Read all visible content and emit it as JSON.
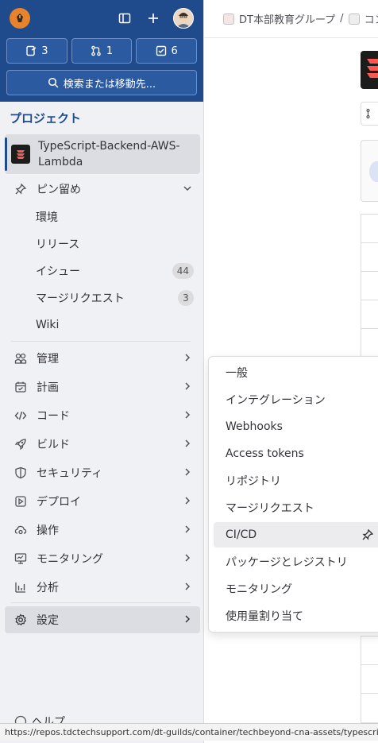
{
  "header": {
    "counters": [
      {
        "icon": "issues-icon",
        "count": "3"
      },
      {
        "icon": "merge-request-icon",
        "count": "1"
      },
      {
        "icon": "todo-icon",
        "count": "6"
      }
    ],
    "search_label": "検索または移動先..."
  },
  "sidebar": {
    "section_title": "プロジェクト",
    "project_name": "TypeScript-Backend-AWS-Lambda",
    "pinned": {
      "label": "ピン留め",
      "items": [
        {
          "label": "環境",
          "badge": ""
        },
        {
          "label": "リリース",
          "badge": ""
        },
        {
          "label": "イシュー",
          "badge": "44"
        },
        {
          "label": "マージリクエスト",
          "badge": "3"
        },
        {
          "label": "Wiki",
          "badge": ""
        }
      ]
    },
    "groups": [
      {
        "label": "管理",
        "icon": "users-icon"
      },
      {
        "label": "計画",
        "icon": "calendar-icon"
      },
      {
        "label": "コード",
        "icon": "code-icon"
      },
      {
        "label": "ビルド",
        "icon": "rocket-icon"
      },
      {
        "label": "セキュリティ",
        "icon": "shield-icon"
      },
      {
        "label": "デプロイ",
        "icon": "deploy-icon"
      },
      {
        "label": "操作",
        "icon": "cloud-gear-icon"
      },
      {
        "label": "モニタリング",
        "icon": "monitor-icon"
      },
      {
        "label": "分析",
        "icon": "chart-icon"
      }
    ],
    "settings_label": "設定",
    "help_label": "ヘルプ"
  },
  "breadcrumb": {
    "group": "DT本部教育グループ",
    "separator": "/",
    "next": "コン"
  },
  "flyout": {
    "items": [
      "一般",
      "インテグレーション",
      "Webhooks",
      "Access tokens",
      "リポジトリ",
      "マージリクエスト",
      "CI/CD",
      "パッケージとレジストリ",
      "モニタリング",
      "使用量割り当て"
    ],
    "active_index": 6
  },
  "status_url": "https://repos.tdctechsupport.com/dt-guilds/container/techbeyond-cna-assets/typescript-"
}
